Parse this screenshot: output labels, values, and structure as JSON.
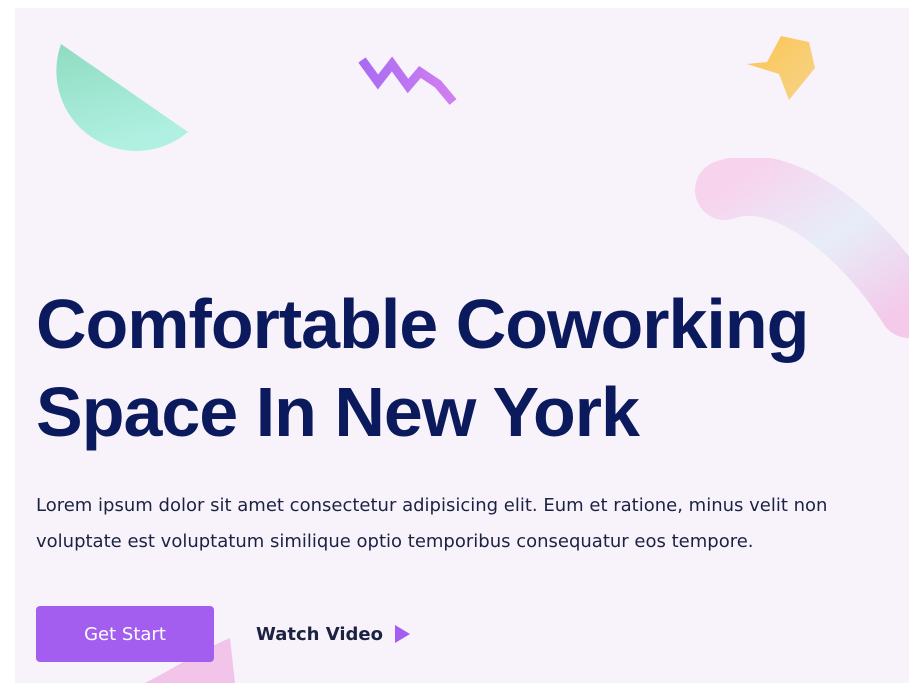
{
  "hero": {
    "title_line1": "Comfortable Coworking",
    "title_line2": "Space In New York",
    "description": "Lorem ipsum dolor sit amet consectetur adipisicing elit. Eum et ratione, minus velit non voluptate est voluptatum similique optio temporibus consequatur eos tempore.",
    "primary_button": "Get Start",
    "video_link": "Watch Video"
  },
  "colors": {
    "background": "#f8f2fb",
    "heading": "#0b1a5c",
    "accent": "#a35ef0"
  },
  "icons": {
    "video": "play-icon"
  }
}
